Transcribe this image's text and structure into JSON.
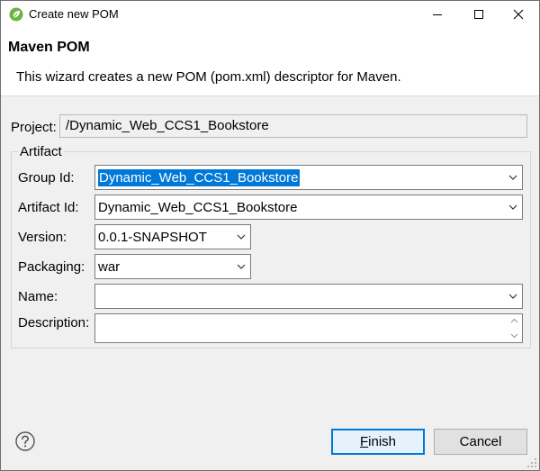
{
  "window": {
    "title": "Create new POM"
  },
  "banner": {
    "title": "Maven POM",
    "description": "This wizard creates a new POM (pom.xml) descriptor for Maven."
  },
  "project": {
    "label": "Project:",
    "value": "/Dynamic_Web_CCS1_Bookstore"
  },
  "artifact": {
    "legend": "Artifact",
    "group_id": {
      "label": "Group Id:",
      "value": "Dynamic_Web_CCS1_Bookstore"
    },
    "artifact_id": {
      "label": "Artifact Id:",
      "value": "Dynamic_Web_CCS1_Bookstore"
    },
    "version": {
      "label": "Version:",
      "value": "0.0.1-SNAPSHOT"
    },
    "packaging": {
      "label": "Packaging:",
      "value": "war"
    },
    "name": {
      "label": "Name:",
      "value": ""
    },
    "description": {
      "label": "Description:",
      "value": ""
    }
  },
  "buttons": {
    "finish_mnemonic": "F",
    "finish_rest": "inish",
    "cancel": "Cancel"
  },
  "icons": {
    "app": "spring-leaf-icon",
    "help": "help-icon"
  },
  "colors": {
    "selection": "#0078d7",
    "app_icon_green": "#6db33f"
  }
}
